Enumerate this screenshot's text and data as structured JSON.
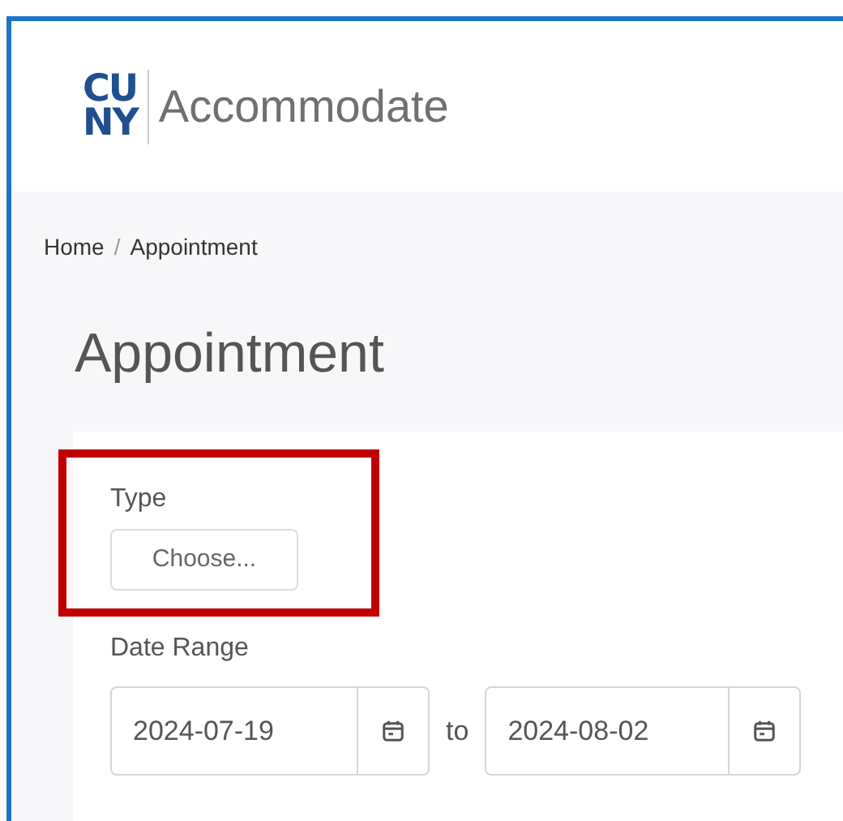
{
  "logo": {
    "lines": [
      "CU",
      "NY"
    ],
    "app_name": "Accommodate"
  },
  "breadcrumb": [
    {
      "label": "Home"
    },
    {
      "label": "Appointment"
    }
  ],
  "breadcrumb_separator": "/",
  "page_title": "Appointment",
  "form": {
    "type": {
      "label": "Type",
      "button": "Choose...",
      "highlighted": true
    },
    "date_range": {
      "label": "Date Range",
      "from": "2024-07-19",
      "separator": "to",
      "to": "2024-08-02"
    }
  }
}
